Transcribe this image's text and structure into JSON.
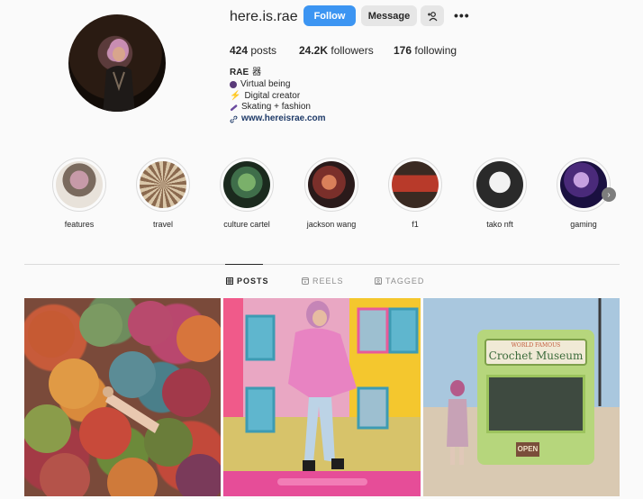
{
  "profile": {
    "username": "here.is.rae",
    "follow_label": "Follow",
    "message_label": "Message",
    "add_user_icon": "person-add-icon",
    "more_icon": "•••"
  },
  "stats": {
    "posts_count": "424",
    "posts_label": "posts",
    "followers_count": "24.2K",
    "followers_label": "followers",
    "following_count": "176",
    "following_label": "following"
  },
  "bio": {
    "name": "RAE",
    "name_emoji": "器",
    "line1": "Virtual being",
    "line2": "Digital creator",
    "line3": "Skating + fashion",
    "link": "www.hereisrae.com",
    "colors": {
      "dot1": "#5a3a7a",
      "bolt": "#f39c12",
      "skate": "#6a4a9e",
      "link_icon": "#1e3a68"
    }
  },
  "highlights": [
    {
      "label": "features",
      "color": "#c79aa8"
    },
    {
      "label": "travel",
      "color": "#8b6a4f"
    },
    {
      "label": "culture cartel",
      "color": "#3f6e4a"
    },
    {
      "label": "jackson wang",
      "color": "#7a2f2a"
    },
    {
      "label": "f1",
      "color": "#6b2a22"
    },
    {
      "label": "tako nft",
      "color": "#e8e8e8"
    },
    {
      "label": "gaming",
      "color": "#4a2a7a"
    }
  ],
  "tabs": {
    "posts": "POSTS",
    "reels": "REELS",
    "tagged": "TAGGED"
  },
  "posts": {
    "post3_sign_small": "WORLD FAMOUS",
    "post3_sign": "Crochet Museum",
    "post3_open": "OPEN"
  },
  "colors": {
    "accent": "#3c95f2",
    "secondary_button": "#e6e6e6",
    "divider": "#dbdbdb"
  }
}
